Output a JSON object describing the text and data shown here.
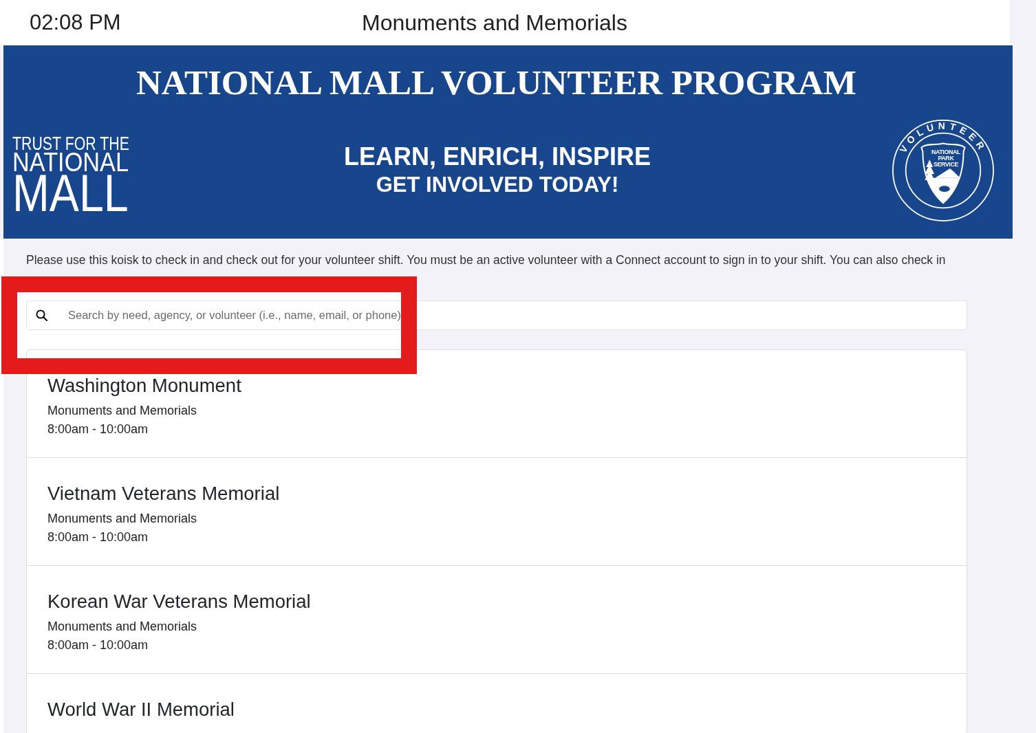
{
  "header": {
    "time": "02:08 PM",
    "title": "Monuments and Memorials"
  },
  "banner": {
    "title": "NATIONAL MALL VOLUNTEER PROGRAM",
    "logo_lines": [
      "TRUST FOR THE",
      "NATIONAL",
      "MALL"
    ],
    "taglines": [
      "LEARN, ENRICH, INSPIRE",
      "GET INVOLVED TODAY!"
    ],
    "badge": {
      "ring_text": "VOLUNTEER",
      "emblem_lines": [
        "NATIONAL",
        "PARK",
        "SERVICE"
      ]
    }
  },
  "intro": "Please use this koisk to check in and check out for your volunteer shift. You must be an active volunteer with a Connect account to sign in to your shift. You can also check in",
  "search": {
    "placeholder": "Search by need, agency, or volunteer (i.e., name, email, or phone)"
  },
  "needs": [
    {
      "title": "Washington Monument",
      "category": "Monuments and Memorials",
      "time": "8:00am - 10:00am"
    },
    {
      "title": "Vietnam Veterans Memorial",
      "category": "Monuments and Memorials",
      "time": "8:00am - 10:00am"
    },
    {
      "title": "Korean War Veterans Memorial",
      "category": "Monuments and Memorials",
      "time": "8:00am - 10:00am"
    },
    {
      "title": "World War II Memorial"
    }
  ],
  "annotation": {
    "kind": "rectangle"
  }
}
